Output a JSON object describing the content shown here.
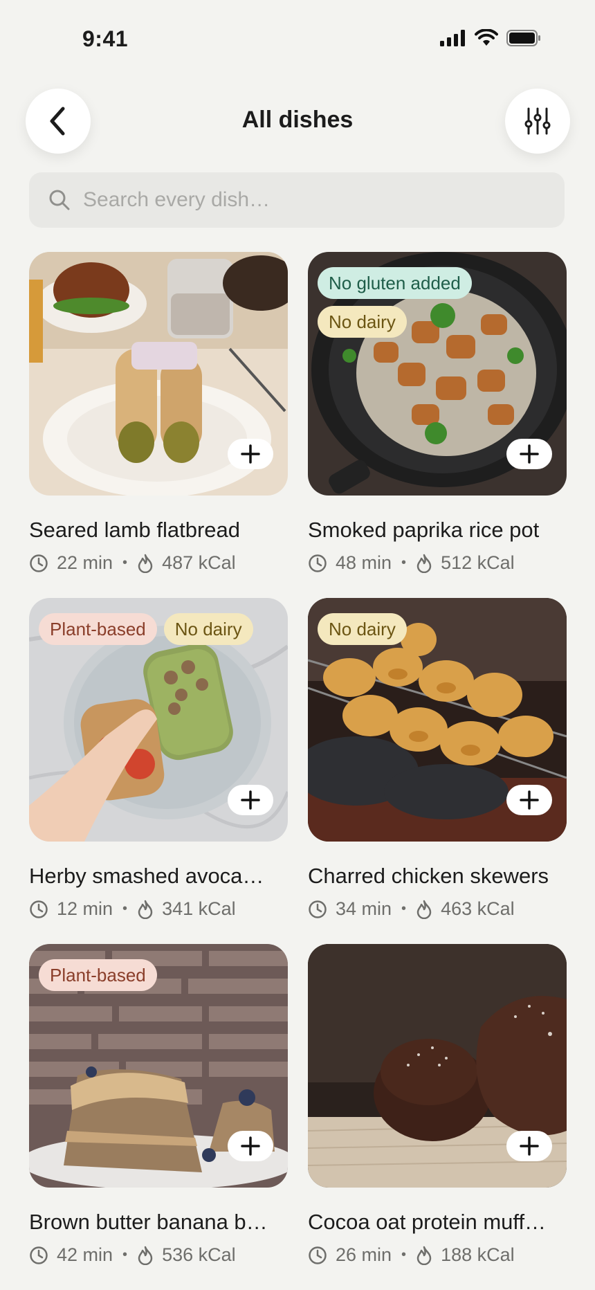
{
  "status_bar": {
    "time": "9:41"
  },
  "header": {
    "title": "All dishes"
  },
  "search": {
    "placeholder": "Search every dish…"
  },
  "dishes": [
    {
      "title": "Seared lamb flatbread",
      "time": "22 min",
      "kcal": "487 kCal",
      "tags": []
    },
    {
      "title": "Smoked paprika rice pot",
      "time": "48 min",
      "kcal": "512 kCal",
      "tags": [
        "No gluten added",
        "No dairy"
      ]
    },
    {
      "title": "Herby smashed avoca…",
      "time": "12 min",
      "kcal": "341 kCal",
      "tags": [
        "Plant-based",
        "No dairy"
      ]
    },
    {
      "title": "Charred chicken skewers",
      "time": "34 min",
      "kcal": "463 kCal",
      "tags": [
        "No dairy"
      ]
    },
    {
      "title": "Brown butter banana b…",
      "time": "42 min",
      "kcal": "536 kCal",
      "tags": [
        "Plant-based"
      ]
    },
    {
      "title": "Cocoa oat protein muff…",
      "time": "26 min",
      "kcal": "188 kCal",
      "tags": []
    }
  ],
  "colors": {
    "background": "#F3F3F0",
    "tag_gluten_bg": "#CFEDE3",
    "tag_dairy_bg": "#F4E8BE",
    "tag_plant_bg": "#F6DCD4"
  }
}
